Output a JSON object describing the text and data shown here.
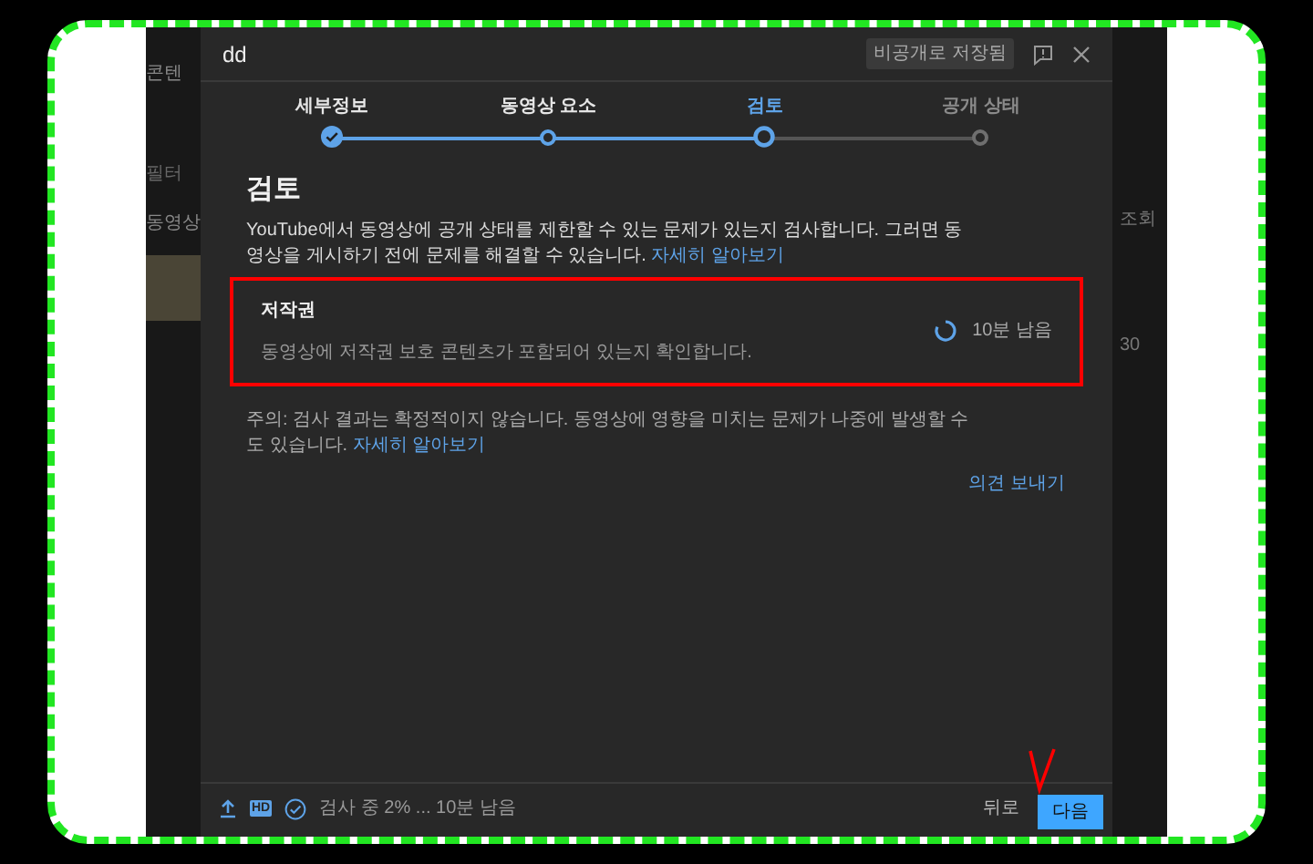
{
  "background_page": {
    "left_texts": [
      "콘텐",
      "필터",
      "동영상"
    ],
    "right_texts": [
      "조회",
      "30"
    ]
  },
  "dialog": {
    "title": "dd",
    "saved_badge": "비공개로 저장됨",
    "steps": [
      {
        "label": "세부정보",
        "kind": "done"
      },
      {
        "label": "동영상 요소",
        "kind": "visited"
      },
      {
        "label": "검토",
        "kind": "current"
      },
      {
        "label": "공개 상태",
        "kind": "pending"
      }
    ],
    "heading": "검토",
    "description": "YouTube에서 동영상에 공개 상태를 제한할 수 있는 문제가 있는지 검사합니다. 그러면 동영상을 게시하기 전에 문제를 해결할 수 있습니다.",
    "description_link": "자세히 알아보기",
    "check": {
      "title": "저작권",
      "text": "동영상에 저작권 보호 콘텐츠가 포함되어 있는지 확인합니다.",
      "status": "10분 남음",
      "highlighted": true
    },
    "caution": "주의: 검사 결과는 확정적이지 않습니다. 동영상에 영향을 미치는 문제가 나중에 발생할 수도 있습니다.",
    "caution_link": "자세히 알아보기",
    "feedback": "의견 보내기",
    "footer": {
      "progress": "검사 중 2% ... 10분 남음",
      "hd_label": "HD",
      "back": "뒤로",
      "next": "다음",
      "next_marked": true
    }
  }
}
